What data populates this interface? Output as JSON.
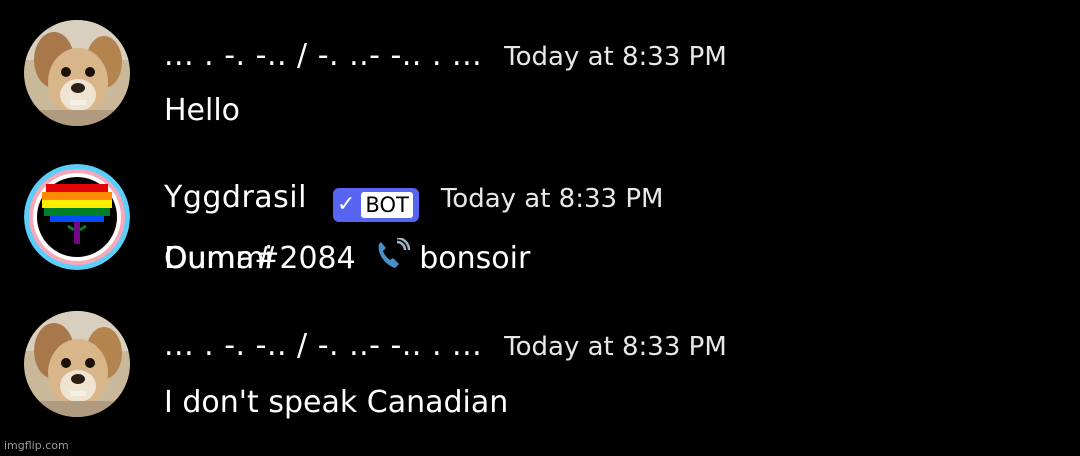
{
  "messages": [
    {
      "username": "... . -. -.. / -. ..- -.. . ...",
      "timestamp": "Today at 8:33 PM",
      "content": "Hello",
      "avatar": "dog-avatar"
    },
    {
      "username": "Yggdrasil",
      "badge": "BOT",
      "badge_check": "✓",
      "timestamp": "Today at 8:33 PM",
      "mention_a": "Ouma",
      "mention_b": "Dummi",
      "mention_suffix": "#2084",
      "icon": "phone-call-icon",
      "content_after": "bonsoir",
      "avatar": "rainbow-tree-avatar"
    },
    {
      "username": "... . -. -.. / -. ..- -.. . ...",
      "timestamp": "Today at 8:33 PM",
      "content": "I don't speak Canadian",
      "avatar": "dog-avatar"
    }
  ],
  "watermark": "imgflip.com",
  "colors": {
    "background": "#000000",
    "badge": "#5865f2",
    "text": "#ffffff"
  }
}
